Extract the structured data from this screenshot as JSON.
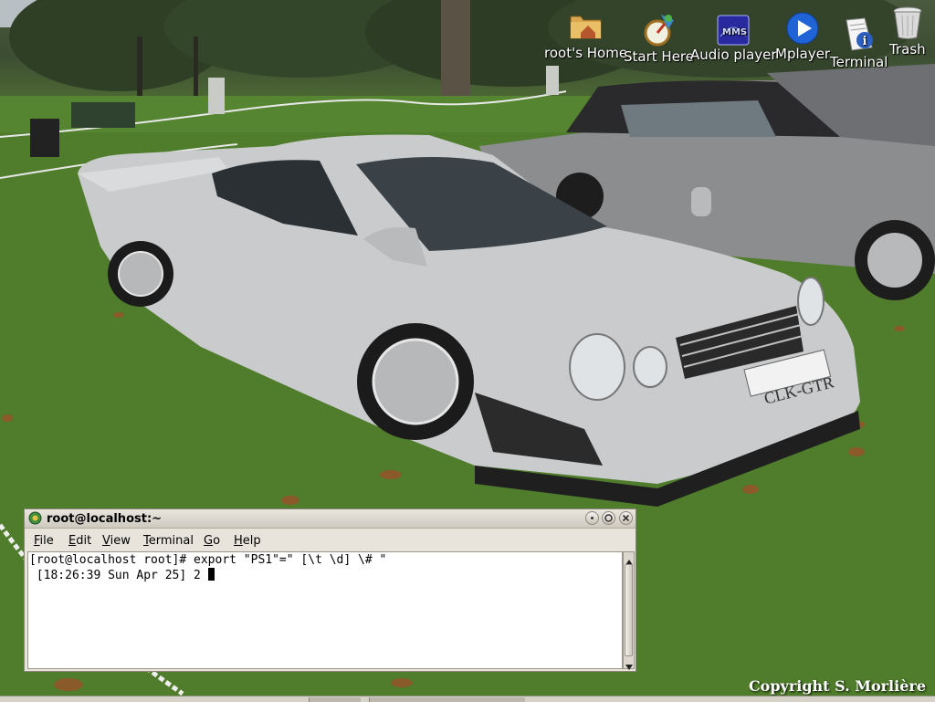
{
  "desktop": {
    "icons": [
      {
        "label": "root's Home",
        "icon": "home-folder-icon"
      },
      {
        "label": "Start Here",
        "icon": "start-here-icon"
      },
      {
        "label": "Audio player",
        "icon": "audio-player-icon"
      },
      {
        "label": "Mplayer",
        "icon": "mplayer-icon"
      },
      {
        "label": "Terminal",
        "icon": "terminal-info-icon"
      },
      {
        "label": "Trash",
        "icon": "trash-icon"
      }
    ],
    "copyright": "Copyright S. Morlière",
    "wallpaper": {
      "plate_text": "CLK-GTR"
    }
  },
  "terminal": {
    "title": "root@localhost:~",
    "menu": [
      "File",
      "Edit",
      "View",
      "Terminal",
      "Go",
      "Help"
    ],
    "menu_mnemonics": [
      "F",
      "E",
      "V",
      "T",
      "G",
      "H"
    ],
    "lines": [
      "[root@localhost root]# export \"PS1\"=\" [\\t \\d] \\# \"",
      " [18:26:39 Sun Apr 25] 2 "
    ]
  },
  "colors": {
    "grass": "#4e7a2a",
    "car_silver": "#c9cbcd",
    "window_bg": "#e8e4dc",
    "titlebar": "#cfcac0"
  }
}
